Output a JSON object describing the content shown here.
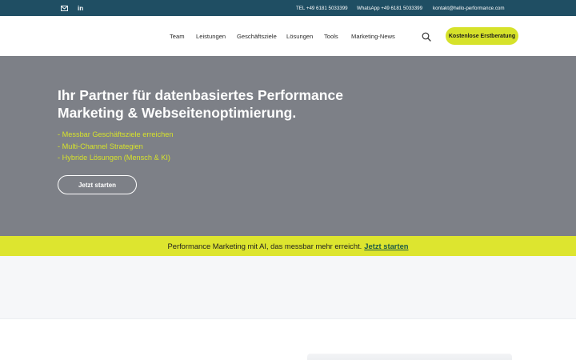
{
  "topbar": {
    "social": {
      "mail_icon": "envelope-icon",
      "linkedin_label": "in"
    },
    "contact": {
      "tel": "TEL +49 6181 5033399",
      "whatsapp": "WhatsApp +49 6181 5033399",
      "email": "kontakt@hello-performance.com"
    }
  },
  "nav": {
    "items": [
      "Team",
      "Leistungen",
      "Geschäftsziele",
      "Lösungen",
      "Tools",
      "Marketing-News"
    ],
    "search_icon": "search-icon",
    "cta_label": "Kostenlose Erstberatung"
  },
  "hero": {
    "title": "Ihr Partner für datenbasiertes Performance Marketing & Webseitenoptimierung.",
    "bullets": [
      "- Messbar Geschäftsziele erreichen",
      "- Multi-Channel Strategien",
      "- Hybride Lösungen (Mensch & KI)"
    ],
    "button_label": "Jetzt starten"
  },
  "banner": {
    "text": "Performance Marketing mit AI, das messbar mehr erreicht.",
    "link_label": "Jetzt starten"
  },
  "colors": {
    "topbar_bg": "#1f4e63",
    "accent": "#d6e22a",
    "hero_bg": "#7d8087",
    "banner_link": "#1e5b47"
  }
}
